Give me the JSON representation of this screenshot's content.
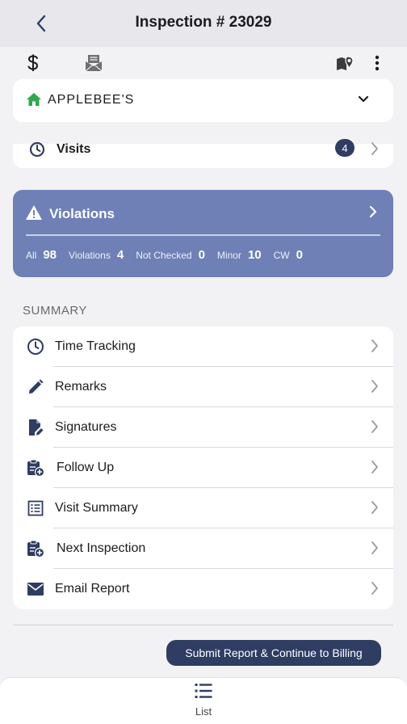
{
  "header": {
    "title": "Inspection # 23029"
  },
  "establishment": {
    "name": "APPLEBEE'S"
  },
  "visits": {
    "label": "Visits",
    "count": "4"
  },
  "violations": {
    "title": "Violations",
    "stats": [
      {
        "label": "All",
        "value": "98"
      },
      {
        "label": "Violations",
        "value": "4"
      },
      {
        "label": "Not Checked",
        "value": "0"
      },
      {
        "label": "Minor",
        "value": "10"
      },
      {
        "label": "CW",
        "value": "0"
      }
    ]
  },
  "summary": {
    "title": "SUMMARY",
    "items": [
      {
        "label": "Time Tracking",
        "icon": "clock-icon"
      },
      {
        "label": "Remarks",
        "icon": "pencil-icon"
      },
      {
        "label": "Signatures",
        "icon": "signature-file-icon"
      },
      {
        "label": "Follow Up",
        "icon": "clipboard-plus-icon"
      },
      {
        "label": "Visit Summary",
        "icon": "list-icon"
      },
      {
        "label": "Next Inspection",
        "icon": "clipboard-plus-icon"
      },
      {
        "label": "Email Report",
        "icon": "envelope-icon"
      }
    ]
  },
  "actions": {
    "submit_label": "Submit Report & Continue to Billing"
  },
  "tabbar": {
    "list_label": "List"
  },
  "colors": {
    "accent": "#2f3d63",
    "violations_card": "#6e80b6",
    "home_icon": "#2fa84f"
  }
}
